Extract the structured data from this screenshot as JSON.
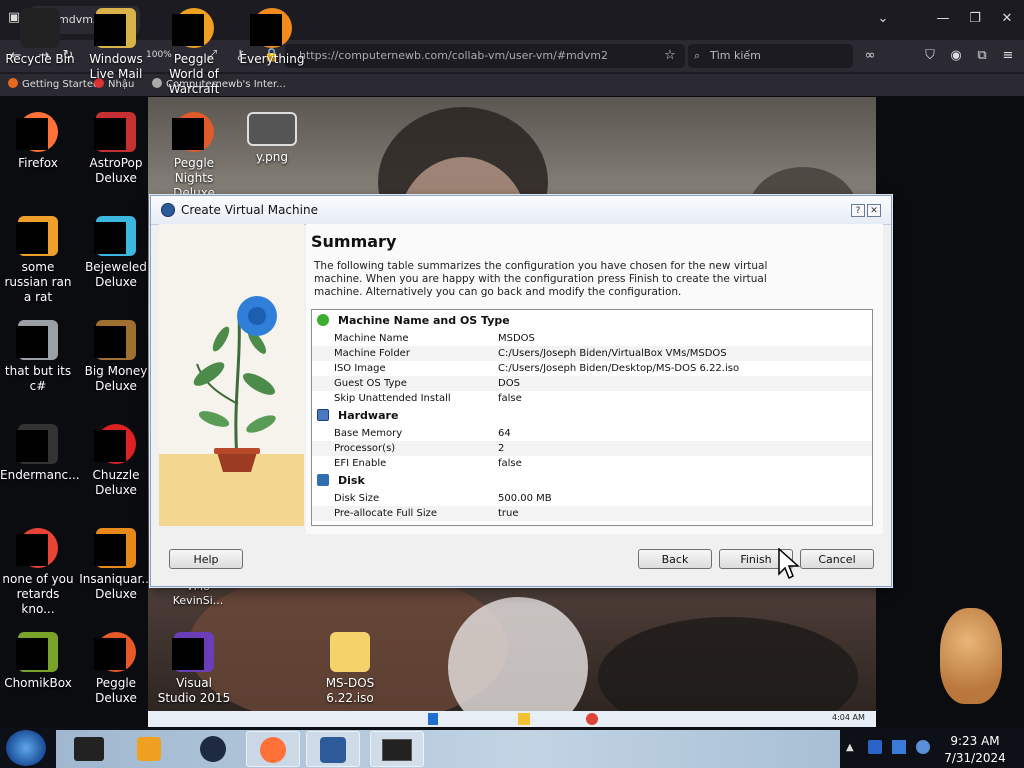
{
  "browser": {
    "tab_title": "mdvm2 - U",
    "url": "https://computernewb.com/collab-vm/user-vm/#mdvm2",
    "search_placeholder": "Tìm kiếm",
    "zoom": "100%",
    "bookmarks": [
      "Getting Started",
      "Nhậu",
      "Computernewb's Inter..."
    ]
  },
  "desktop_icons": [
    {
      "label": "Recycle Bin"
    },
    {
      "label": "Windows Live Mail"
    },
    {
      "label": "Peggle World of Warcraft"
    },
    {
      "label": "Everything"
    },
    {
      "label": "Firefox"
    },
    {
      "label": "AstroPop Deluxe"
    },
    {
      "label": "Peggle Nights Deluxe"
    },
    {
      "label": "y.png"
    },
    {
      "label": "some russian ran a rat"
    },
    {
      "label": "Bejeweled Deluxe"
    },
    {
      "label": "that but its c#"
    },
    {
      "label": "Big Money Deluxe"
    },
    {
      "label": "Endermanc..."
    },
    {
      "label": "Chuzzle Deluxe"
    },
    {
      "label": "none of you retards kno..."
    },
    {
      "label": "Insaniquar... Deluxe"
    },
    {
      "label": "ChomikBox"
    },
    {
      "label": "Peggle Deluxe"
    },
    {
      "label": "Visual Studio 2015"
    },
    {
      "label": "MS-DOS 6.22.iso"
    },
    {
      "label": "VMo KevinSi..."
    }
  ],
  "dialog": {
    "title": "Create Virtual Machine",
    "help_glyph": "?",
    "close_glyph": "✕",
    "heading": "Summary",
    "description": "The following table summarizes the configuration you have chosen for the new virtual machine. When you are happy with the configuration press Finish to create the virtual machine. Alternatively you can go back and modify the configuration.",
    "groups": [
      {
        "name": "Machine Name and OS Type",
        "color": "#3cae2f",
        "rows": [
          {
            "key": "Machine Name",
            "value": "MSDOS"
          },
          {
            "key": "Machine Folder",
            "value": "C:/Users/Joseph Biden/VirtualBox VMs/MSDOS"
          },
          {
            "key": "ISO Image",
            "value": "C:/Users/Joseph Biden/Desktop/MS-DOS 6.22.iso"
          },
          {
            "key": "Guest OS Type",
            "value": "DOS"
          },
          {
            "key": "Skip Unattended Install",
            "value": "false"
          }
        ]
      },
      {
        "name": "Hardware",
        "color": "#4a78c2",
        "rows": [
          {
            "key": "Base Memory",
            "value": "64"
          },
          {
            "key": "Processor(s)",
            "value": "2"
          },
          {
            "key": "EFI Enable",
            "value": "false"
          }
        ]
      },
      {
        "name": "Disk",
        "color": "#2f6fb0",
        "rows": [
          {
            "key": "Disk Size",
            "value": "500.00 MB"
          },
          {
            "key": "Pre-allocate Full Size",
            "value": "true"
          }
        ]
      }
    ],
    "buttons": {
      "help": "Help",
      "back": "Back",
      "finish": "Finish",
      "cancel": "Cancel"
    }
  },
  "vm_clock": "4:04 AM",
  "taskbar": {
    "time": "9:23 AM",
    "date": "7/31/2024"
  },
  "colors": {
    "accent": "#2d5b9a",
    "taskbar": "#a8bfd4",
    "dialog_bg": "#f0f0f0"
  }
}
